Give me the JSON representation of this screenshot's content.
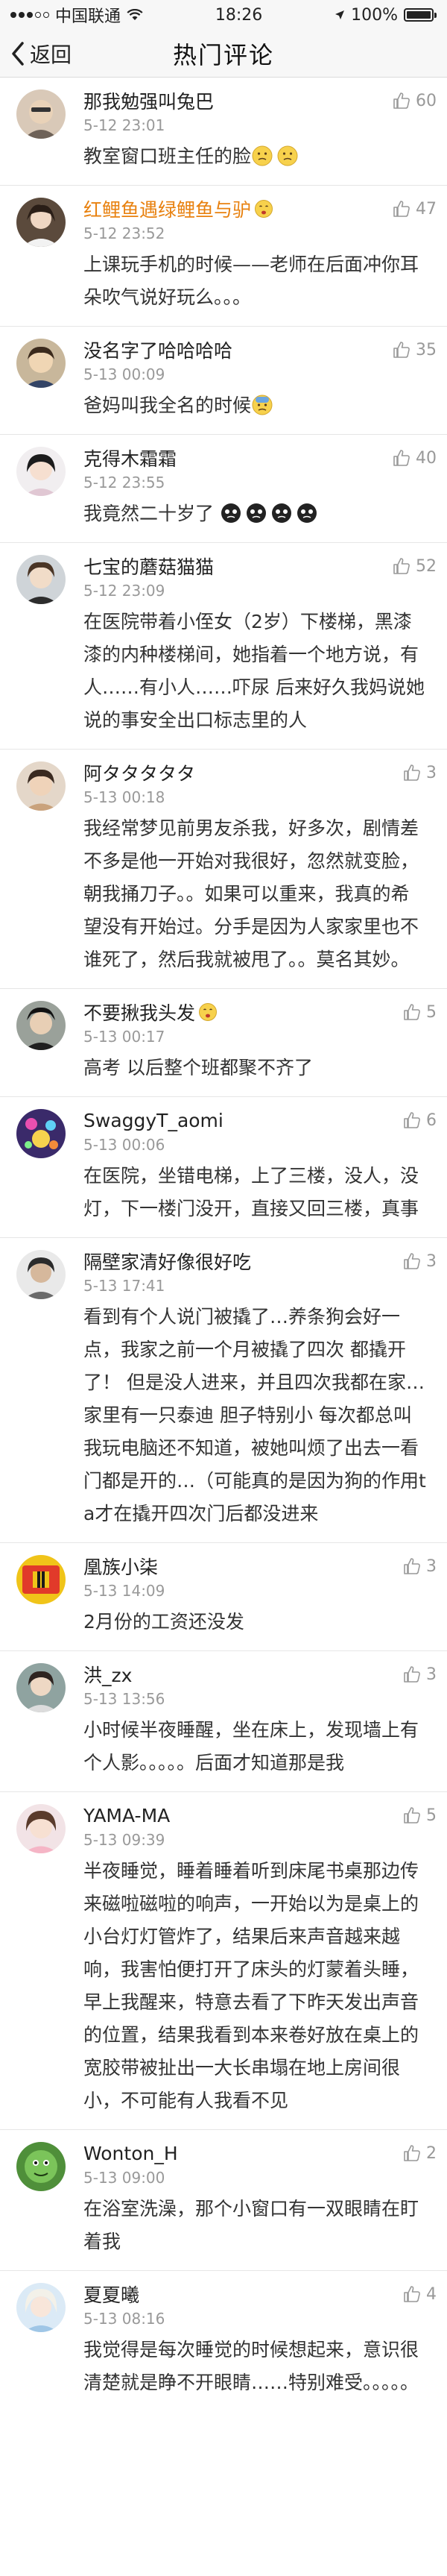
{
  "status_bar": {
    "carrier": "中国联通",
    "time": "18:26",
    "battery": "100%"
  },
  "nav": {
    "back_label": "返回",
    "title": "热门评论"
  },
  "comments": [
    {
      "username": "那我勉强叫兔巴",
      "time": "5-12 23:01",
      "likes": "60",
      "content": "教室窗口班主任的脸"
    },
    {
      "username": "红鲤鱼遇绿鲤鱼与驴",
      "time": "5-12 23:52",
      "likes": "47",
      "content": "上课玩手机的时候——老师在后面冲你耳朵吹气说好玩么。。。"
    },
    {
      "username": "没名字了哈哈哈哈",
      "time": "5-13 00:09",
      "likes": "35",
      "content": "爸妈叫我全名的时候"
    },
    {
      "username": "克得木霜霜",
      "time": "5-12 23:55",
      "likes": "40",
      "content": "我竟然二十岁了"
    },
    {
      "username": "七宝的蘑菇猫猫",
      "time": "5-12 23:09",
      "likes": "52",
      "content": "在医院带着小侄女（2岁）下楼梯，黑漆漆的内种楼梯间，她指着一个地方说，有人……有小人……吓尿 后来好久我妈说她说的事安全出口标志里的人"
    },
    {
      "username": "阿タタタタタ",
      "time": "5-13 00:18",
      "likes": "3",
      "content": "我经常梦见前男友杀我，好多次，剧情差不多是他一开始对我很好，忽然就变脸，朝我捅刀子。。如果可以重来，我真的希望没有开始过。分手是因为人家家里也不谁死了，然后我就被甩了。。莫名其妙。"
    },
    {
      "username": "不要揪我头发",
      "time": "5-13 00:17",
      "likes": "5",
      "content": "高考 以后整个班都聚不齐了"
    },
    {
      "username": "SwaggyT_aomi",
      "time": "5-13 00:06",
      "likes": "6",
      "content": "在医院，坐错电梯，上了三楼，没人，没灯，下一楼门没开，直接又回三楼，真事"
    },
    {
      "username": "隔壁家清好像很好吃",
      "time": "5-13 17:41",
      "likes": "3",
      "content": "看到有个人说门被撬了…养条狗会好一点，我家之前一个月被撬了四次 都撬开了！ 但是没人进来，并且四次我都在家… 家里有一只泰迪 胆子特别小 每次都总叫 我玩电脑还不知道，被她叫烦了出去一看门都是开的…（可能真的是因为狗的作用ta才在撬开四次门后都没进来"
    },
    {
      "username": "凰族小柒",
      "time": "5-13 14:09",
      "likes": "3",
      "content": "2月份的工资还没发"
    },
    {
      "username": "洪_zx",
      "time": "5-13 13:56",
      "likes": "3",
      "content": "小时候半夜睡醒，坐在床上，发现墙上有个人影。。。。。后面才知道那是我"
    },
    {
      "username": "YAMA-MA",
      "time": "5-13 09:39",
      "likes": "5",
      "content": "半夜睡觉，睡着睡着听到床尾书桌那边传来磁啦磁啦的响声，一开始以为是桌上的小台灯灯管炸了，结果后来声音越来越响，我害怕便打开了床头的灯蒙着头睡，早上我醒来，特意去看了下昨天发出声音的位置，结果我看到本来卷好放在桌上的宽胶带被扯出一大长串塌在地上房间很小，不可能有人我看不见"
    },
    {
      "username": "Wonton_H",
      "time": "5-13 09:00",
      "likes": "2",
      "content": "在浴室洗澡，那个小窗口有一双眼睛在盯着我"
    },
    {
      "username": "夏夏曦",
      "time": "5-13 08:16",
      "likes": "4",
      "content": "我觉得是每次睡觉的时候想起来，意识很清楚就是睁不开眼睛……特别难受。。。。。"
    }
  ]
}
